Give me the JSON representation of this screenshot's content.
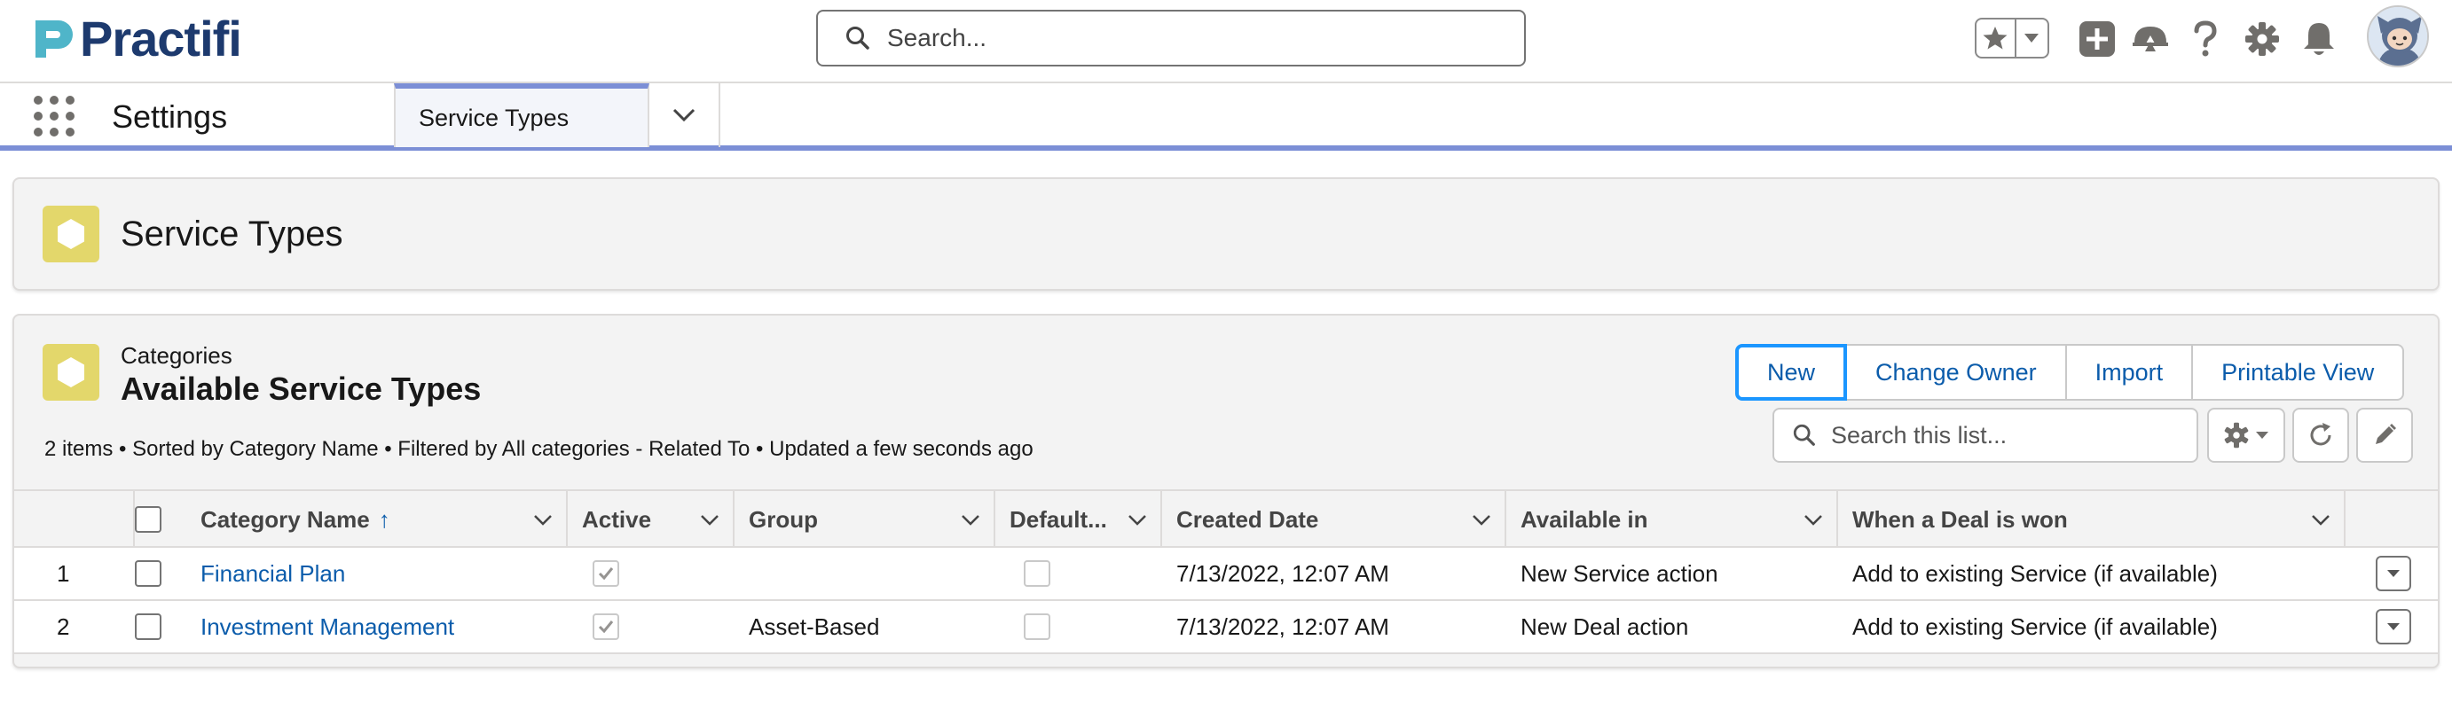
{
  "brand": {
    "name": "Practifi"
  },
  "global_search": {
    "placeholder": "Search..."
  },
  "header_icons": [
    "star-icon",
    "chevron-down-icon",
    "add-icon",
    "trailhead-icon",
    "help-icon",
    "gear-icon",
    "bell-icon",
    "avatar"
  ],
  "nav": {
    "app_name": "Settings",
    "active_tab": "Service Types"
  },
  "page_header": {
    "title": "Service Types"
  },
  "list_view": {
    "eyebrow": "Categories",
    "title": "Available Service Types",
    "meta": "2 items • Sorted by Category Name • Filtered by All categories - Related To • Updated a few seconds ago",
    "buttons": {
      "new": "New",
      "change_owner": "Change Owner",
      "import": "Import",
      "printable_view": "Printable View"
    },
    "search_placeholder": "Search this list..."
  },
  "table": {
    "columns": {
      "category_name": "Category Name",
      "active": "Active",
      "group": "Group",
      "default": "Default...",
      "created_date": "Created Date",
      "available_in": "Available in",
      "when_deal_won": "When a Deal is won"
    },
    "sort_indicator": "↑",
    "rows": [
      {
        "num": "1",
        "category_name": "Financial Plan",
        "active": true,
        "group": "",
        "default": false,
        "created_date": "7/13/2022, 12:07 AM",
        "available_in": "New Service action",
        "when_deal_won": "Add to existing Service (if available)"
      },
      {
        "num": "2",
        "category_name": "Investment Management",
        "active": true,
        "group": "Asset-Based",
        "default": false,
        "created_date": "7/13/2022, 12:07 AM",
        "available_in": "New Deal action",
        "when_deal_won": "Add to existing Service (if available)"
      }
    ]
  },
  "colors": {
    "brand_navy": "#1d3a6e",
    "brand_teal": "#4fb5c9",
    "link_blue": "#0b5cab",
    "object_icon_yellow": "#e3d76b",
    "nav_accent": "#7c8fd6",
    "focus_blue": "#1b96ff"
  }
}
